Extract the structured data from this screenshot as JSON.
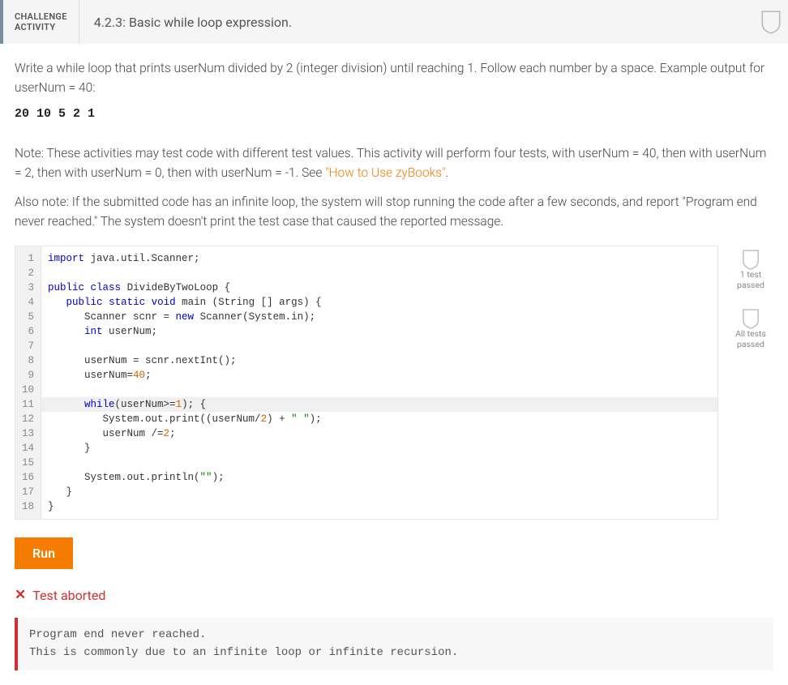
{
  "header": {
    "activity_line1": "CHALLENGE",
    "activity_line2": "ACTIVITY",
    "title": "4.2.3: Basic while loop expression."
  },
  "instructions": {
    "p1": "Write a while loop that prints userNum divided by 2 (integer division) until reaching 1. Follow each number by a space. Example output for userNum = 40:",
    "example_output": "20 10 5 2 1",
    "p2_before": "Note: These activities may test code with different test values. This activity will perform four tests, with userNum = 40, then with userNum = 2, then with userNum = 0, then with userNum = -1. See ",
    "p2_link": "\"How to Use zyBooks\"",
    "p2_after": ".",
    "p3": "Also note: If the submitted code has an infinite loop, the system will stop running the code after a few seconds, and report \"Program end never reached.\" The system doesn't print the test case that caused the reported message."
  },
  "code": {
    "lines": [
      {
        "n": 1,
        "raw": "import java.util.Scanner;"
      },
      {
        "n": 2,
        "raw": ""
      },
      {
        "n": 3,
        "raw": "public class DivideByTwoLoop {"
      },
      {
        "n": 4,
        "raw": "   public static void main (String [] args) {"
      },
      {
        "n": 5,
        "raw": "      Scanner scnr = new Scanner(System.in);"
      },
      {
        "n": 6,
        "raw": "      int userNum;"
      },
      {
        "n": 7,
        "raw": ""
      },
      {
        "n": 8,
        "raw": "      userNum = scnr.nextInt();"
      },
      {
        "n": 9,
        "raw": "      userNum=40;"
      },
      {
        "n": 10,
        "raw": ""
      },
      {
        "n": 11,
        "raw": "      while(userNum>=1); {",
        "hl": true
      },
      {
        "n": 12,
        "raw": "         System.out.print((userNum/2) + \" \");"
      },
      {
        "n": 13,
        "raw": "         userNum /=2;"
      },
      {
        "n": 14,
        "raw": "      }"
      },
      {
        "n": 15,
        "raw": ""
      },
      {
        "n": 16,
        "raw": "      System.out.println(\"\");"
      },
      {
        "n": 17,
        "raw": "   }"
      },
      {
        "n": 18,
        "raw": "}"
      }
    ]
  },
  "side_checks": {
    "c1_line1": "1 test",
    "c1_line2": "passed",
    "c2_line1": "All tests",
    "c2_line2": "passed"
  },
  "run_label": "Run",
  "abort_text": "Test aborted",
  "error_box": {
    "line1": "Program end never reached.",
    "line2": "This is commonly due to an infinite loop or infinite recursion."
  }
}
